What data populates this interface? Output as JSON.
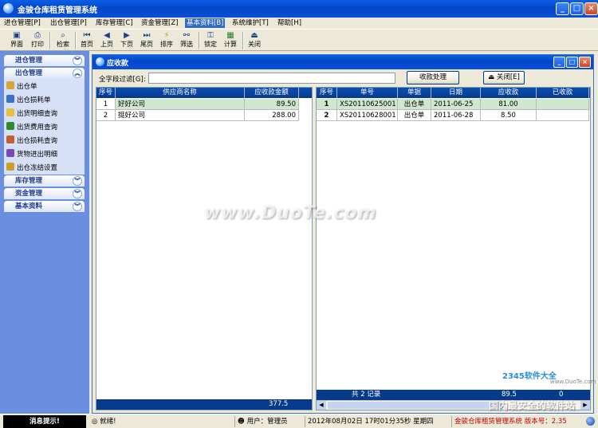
{
  "app": {
    "title": "金骏仓库租赁管理系统"
  },
  "menu": [
    "进仓管理[P]",
    "出仓管理[P]",
    "库存管理[C]",
    "资金管理[Z]",
    "基本资料[B]",
    "系统维护[T]",
    "帮助[H]"
  ],
  "toolbar": [
    {
      "label": "界面",
      "icon": "window-icon"
    },
    {
      "label": "打印",
      "icon": "printer-icon"
    },
    {
      "label": "检索",
      "icon": "search-icon"
    },
    {
      "label": "首页",
      "icon": "first-page-icon"
    },
    {
      "label": "上页",
      "icon": "prev-page-icon"
    },
    {
      "label": "下页",
      "icon": "next-page-icon"
    },
    {
      "label": "尾页",
      "icon": "last-page-icon"
    },
    {
      "label": "排序",
      "icon": "sort-icon"
    },
    {
      "label": "筛选",
      "icon": "filter-icon"
    },
    {
      "label": "锁定",
      "icon": "lock-icon"
    },
    {
      "label": "计算",
      "icon": "calculator-icon"
    },
    {
      "label": "关闭",
      "icon": "close-door-icon"
    }
  ],
  "sidebar": {
    "groups": [
      "进仓管理",
      "出仓管理",
      "库存管理",
      "资金管理",
      "基本资料"
    ],
    "items": [
      "出仓单",
      "出仓损耗单",
      "出货明细查询",
      "出货费用查询",
      "出仓损耗查询",
      "货物进出明细",
      "出仓冻结设置"
    ]
  },
  "window": {
    "title": "应收款",
    "filter_label": "全字段过滤[G]:",
    "filter_value": "",
    "btn_process": "收款处理",
    "btn_close": "关闭[E]"
  },
  "left_grid": {
    "headers": [
      "序号",
      "供应商名称",
      "应收款金额"
    ],
    "rows": [
      [
        "1",
        "好好公司",
        "89.50"
      ],
      [
        "2",
        "挺好公司",
        "288.00"
      ]
    ],
    "total": "377.5"
  },
  "right_grid": {
    "headers": [
      "序号",
      "单号",
      "单据",
      "日期",
      "应收款",
      "已收款"
    ],
    "rows": [
      [
        "1",
        "XS20110625001",
        "出仓单",
        "2011-06-25",
        "81.00",
        ""
      ],
      [
        "2",
        "XS20110628001",
        "出仓单",
        "2011-06-28",
        "8.50",
        ""
      ]
    ],
    "footer_count": "共 2 记录",
    "footer_total": "89.5",
    "footer_received": "0"
  },
  "status": {
    "hint": "消息提示!",
    "ready": "就绪!",
    "user": "用户：管理员",
    "datetime": "2012年08月02日 17时01分35秒 星期四",
    "version": "金骏仓库租赁管理系统 版本号：2.35"
  },
  "watermark": {
    "main": "www.DuoTe.com",
    "brand": "2345软件大全",
    "tagline": "国内最安全的软件站",
    "url": "www.DuoTe.com"
  },
  "colors": {
    "title_blue": "#0a4fd8",
    "grid_head": "#063a8a",
    "sidebar_bg": "#6b8fe0",
    "selected_row": "#cfe6cf"
  }
}
